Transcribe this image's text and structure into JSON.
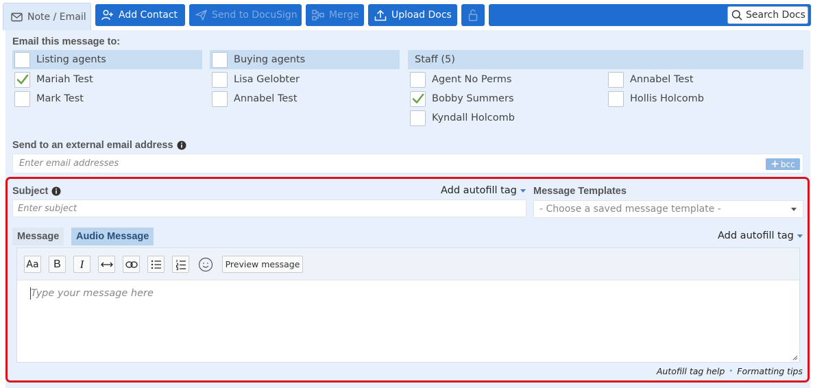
{
  "toolbar": {
    "note_tab": "Note / Email",
    "add_contact": "Add Contact",
    "send_docusign": "Send to DocuSign",
    "merge": "Merge",
    "upload_docs": "Upload Docs",
    "search_docs": "Search Docs"
  },
  "recipients": {
    "heading": "Email this message to:",
    "listing": {
      "header": "Listing agents",
      "items": [
        {
          "name": "Mariah Test",
          "checked": true
        },
        {
          "name": "Mark Test",
          "checked": false
        }
      ]
    },
    "buying": {
      "header": "Buying agents",
      "items": [
        {
          "name": "Lisa Gelobter",
          "checked": false
        },
        {
          "name": "Annabel Test",
          "checked": false
        }
      ]
    },
    "staff": {
      "header": "Staff (5)",
      "items": [
        {
          "name": "Agent No Perms",
          "checked": false
        },
        {
          "name": "Bobby Summers",
          "checked": true
        },
        {
          "name": "Kyndall Holcomb",
          "checked": false
        },
        {
          "name": "Annabel Test",
          "checked": false
        },
        {
          "name": "Hollis Holcomb",
          "checked": false
        }
      ]
    }
  },
  "external": {
    "label": "Send to an external email address",
    "placeholder": "Enter email addresses",
    "bcc": "bcc"
  },
  "compose": {
    "subject_label": "Subject",
    "subject_placeholder": "Enter subject",
    "autofill_label": "Add autofill tag",
    "templates_label": "Message Templates",
    "templates_value": "- Choose a saved message template -",
    "tab_message": "Message",
    "tab_audio": "Audio Message",
    "autofill_label2": "Add autofill tag",
    "preview_button": "Preview message",
    "body_placeholder": "Type your message here",
    "help_link": "Autofill tag help",
    "separator": "•",
    "tips_link": "Formatting tips"
  },
  "colors": {
    "primary": "#1f6ecf",
    "panel": "#e8f1fb",
    "highlight_border": "#d8131e",
    "check": "#6ba34a"
  }
}
